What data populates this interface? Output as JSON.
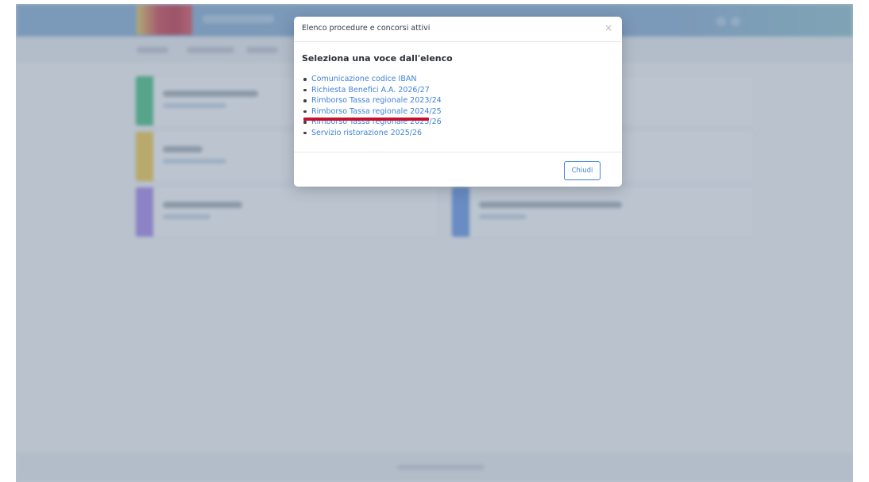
{
  "modal": {
    "title": "Elenco procedure e concorsi attivi",
    "close_icon": "×",
    "heading": "Seleziona una voce dall'elenco",
    "items": [
      {
        "label": "Comunicazione codice IBAN"
      },
      {
        "label": "Richiesta Benefici A.A. 2026/27"
      },
      {
        "label": "Rimborso Tassa regionale 2023/24"
      },
      {
        "label": "Rimborso Tassa regionale 2024/25"
      },
      {
        "label": "Rimborso Tassa regionale 2025/26"
      },
      {
        "label": "Servizio ristorazione 2025/26"
      }
    ],
    "close_button_label": "Chiudi"
  },
  "icons": {
    "modal_close": "close-icon",
    "list_bullet": "bullet-icon"
  },
  "colors": {
    "link": "#3f83d6",
    "highlight_underline": "#c8102e",
    "topbar": "#7fa6cf",
    "card_stripes": [
      "#3fb87f",
      "#e8c24a",
      "#9b7fe6",
      "#5e8fe0"
    ]
  }
}
